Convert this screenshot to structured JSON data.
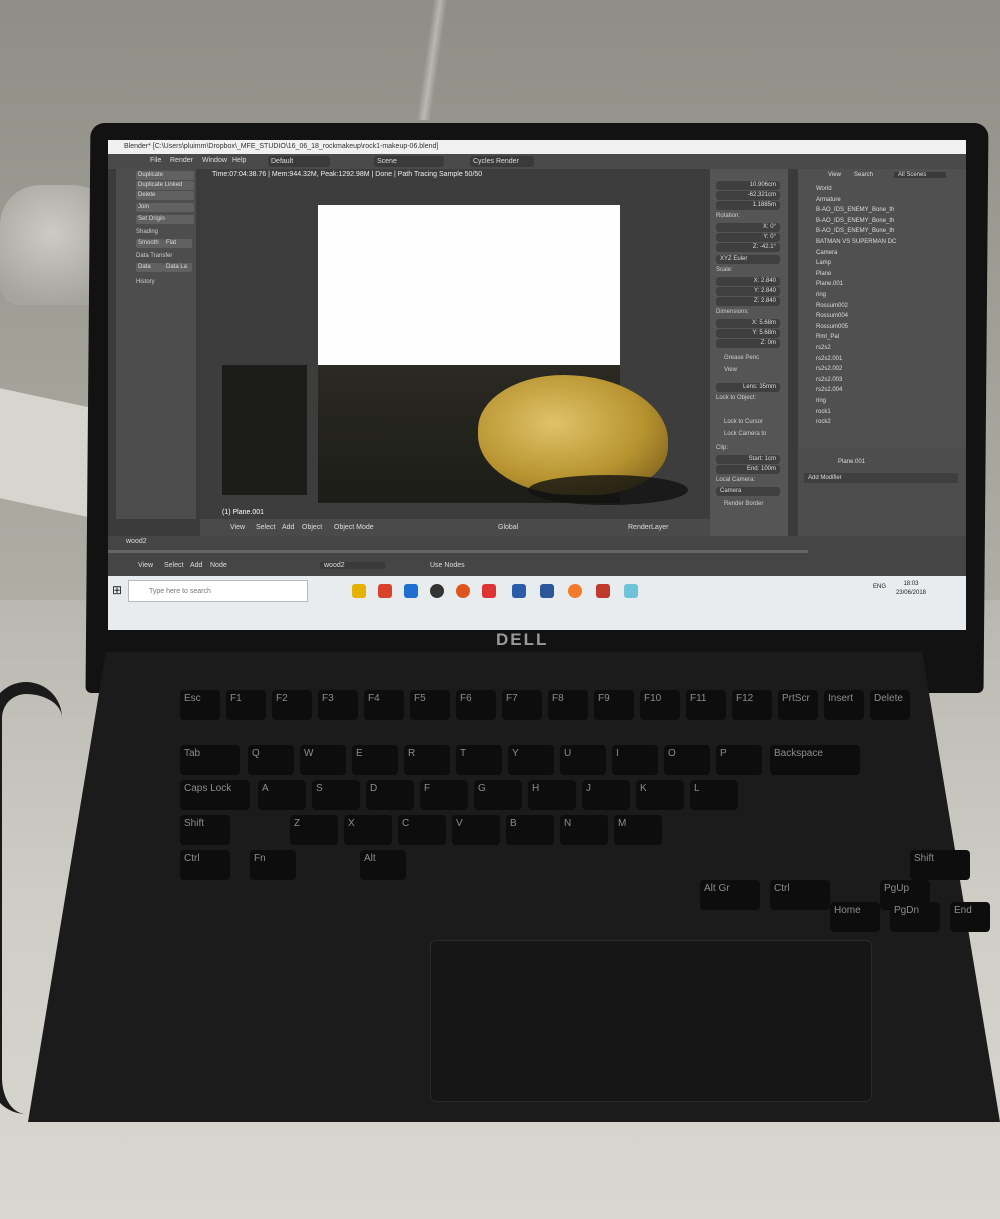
{
  "blender": {
    "window_title": "Blender* [C:\\Users\\pluimm\\Dropbox\\_MFE_STUDIO\\16_06_18_rockmakeup\\rock1-makeup-06.blend]",
    "menu": [
      "File",
      "Render",
      "Window",
      "Help"
    ],
    "layout": "Default",
    "scene": "Scene",
    "engine": "Cycles Render",
    "status": "Time:07:04:38.76 | Mem:944.32M, Peak:1292.98M | Done | Path Tracing Sample 50/50",
    "tools": [
      "Duplicate",
      "Duplicate Linked",
      "Delete",
      "Join",
      "Set Origin",
      "Shading",
      "Smooth",
      "Flat",
      "Data Transfer",
      "Data",
      "Data La",
      "History"
    ],
    "viewport_label": "(1) Plane.001",
    "view_header": [
      "View",
      "Select",
      "Add",
      "Object",
      "Object Mode",
      "Global",
      "RenderLayer"
    ],
    "properties": {
      "location": [
        "10.906cm",
        "-62.321cm",
        "1.1885m"
      ],
      "rotation_label": "Rotation:",
      "rotation": [
        "X: 0°",
        "Y: 0°",
        "Z: -42.1°"
      ],
      "rotation_mode": "XYZ Euler",
      "scale_label": "Scale:",
      "scale": [
        "X: 2.840",
        "Y: 2.840",
        "Z: 2.840"
      ],
      "dimensions_label": "Dimensions:",
      "dimensions": [
        "X: 5.68m",
        "Y: 5.68m",
        "Z: 0m"
      ],
      "grease_pencil": "Grease Penc",
      "view": "View",
      "lens": "Lens: 35mm",
      "lock_to_object": "Lock to Object:",
      "lock_to_cursor": "Lock to Cursor",
      "lock_camera": "Lock Camera to",
      "clip_label": "Clip:",
      "clip_start": "Start: 1cm",
      "clip_end": "End: 100m",
      "local_camera": "Local Camera:",
      "camera": "Camera",
      "render_border": "Render Border"
    },
    "outliner": {
      "header": [
        "View",
        "Search",
        "All Scenes"
      ],
      "items": [
        "World",
        "Armature",
        "B-AO_IDS_ENEMY_Bone_th",
        "B-AO_IDS_ENEMY_Bone_th",
        "B-AO_IDS_ENEMY_Bone_th",
        "BATMAN VS SUPERMAN DC",
        "Camera",
        "Lamp",
        "Plane",
        "Plane.001",
        "ring",
        "Rossum002",
        "Rossum004",
        "Rossum005",
        "Rmt_Pal",
        "rs2s2",
        "rs2s2.001",
        "rs2s2.002",
        "rs2s2.003",
        "rs2s2.004",
        "ring",
        "rock1",
        "rock2"
      ]
    },
    "modifier": {
      "object": "Plane.001",
      "add_modifier": "Add Modifier"
    },
    "node_bar": {
      "material": "wood2",
      "menu": [
        "View",
        "Select",
        "Add",
        "Node"
      ],
      "node_tree": "wood2",
      "use_nodes": "Use Nodes"
    }
  },
  "taskbar": {
    "search_placeholder": "Type here to search",
    "language": "ENG",
    "time": "18:03",
    "date": "23/06/2018"
  },
  "laptop": {
    "brand": "DELL",
    "keys": [
      "Esc",
      "F1",
      "F2",
      "F3",
      "F4",
      "F5",
      "F6",
      "F7",
      "F8",
      "F9",
      "F10",
      "F11",
      "F12",
      "PrtScr",
      "Insert",
      "Delete",
      "Tab",
      "Q",
      "W",
      "E",
      "R",
      "T",
      "Y",
      "U",
      "I",
      "O",
      "P",
      "Backspace",
      "Caps Lock",
      "A",
      "S",
      "D",
      "F",
      "G",
      "H",
      "J",
      "K",
      "L",
      "Shift",
      "Z",
      "X",
      "C",
      "V",
      "B",
      "N",
      "M",
      "Shift",
      "Ctrl",
      "Fn",
      "Alt",
      "Alt Gr",
      "Ctrl",
      "PgUp",
      "Home",
      "PgDn",
      "End"
    ]
  }
}
